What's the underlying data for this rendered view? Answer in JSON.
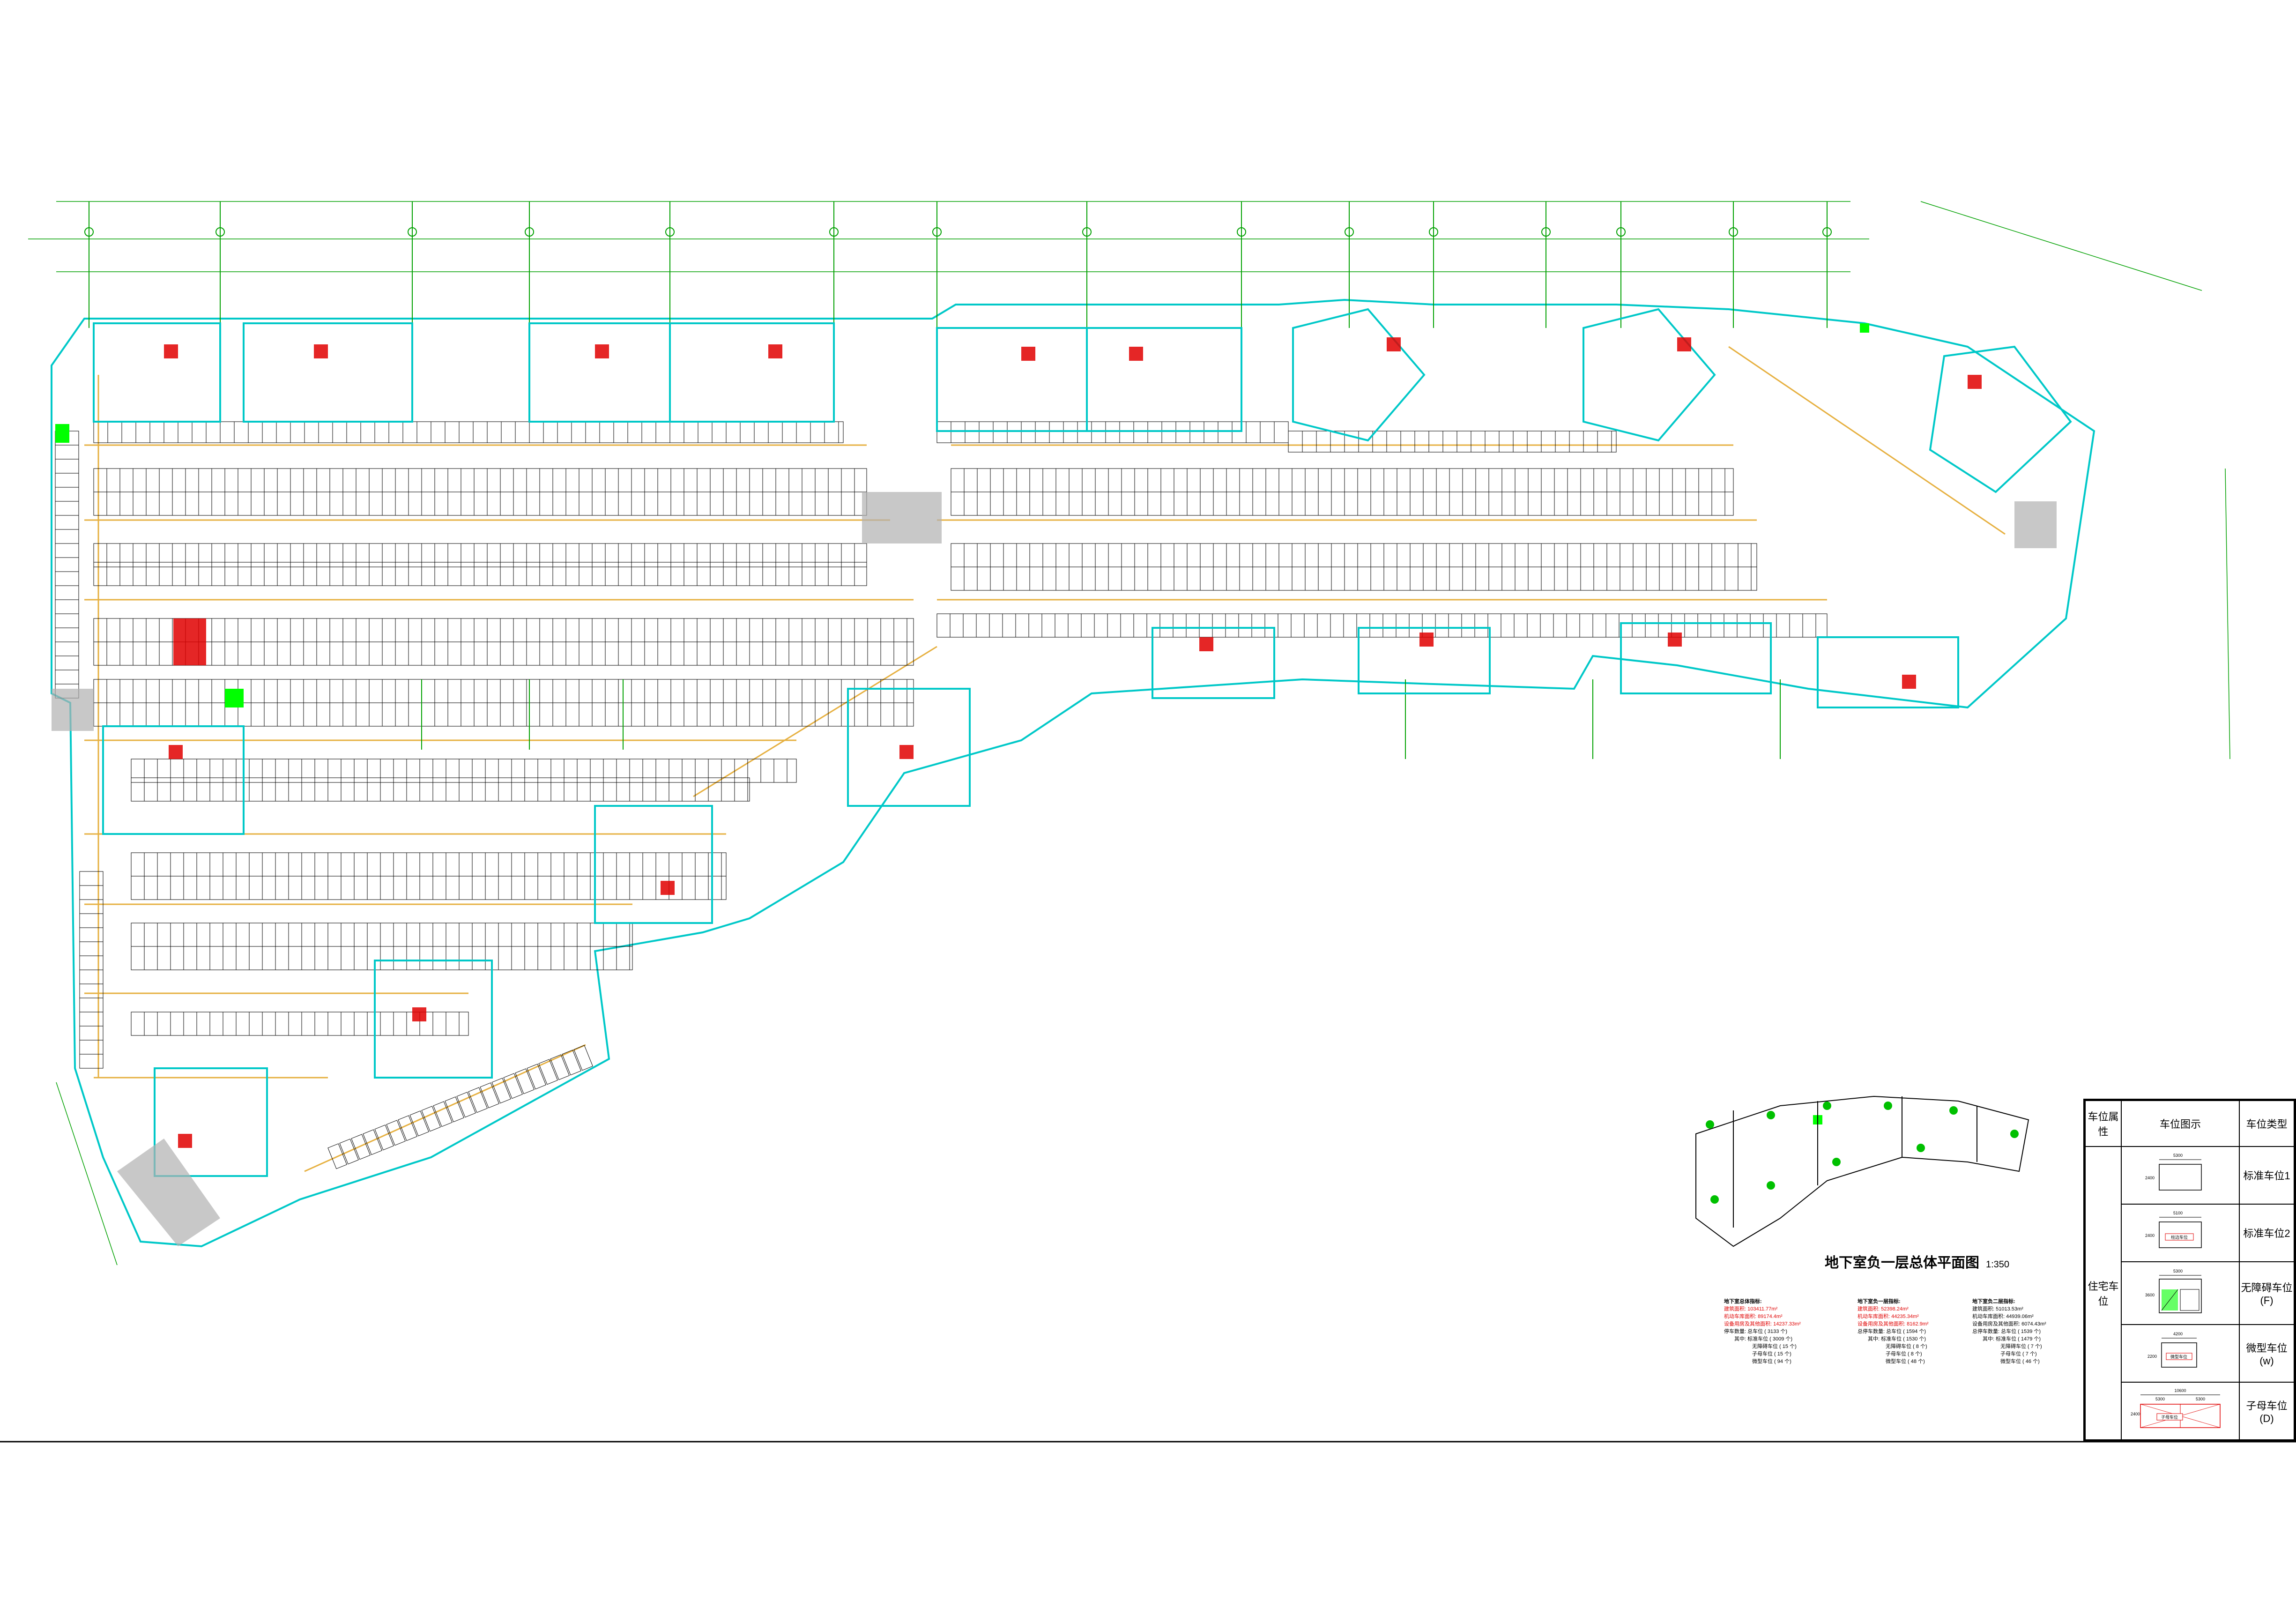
{
  "drawing": {
    "title": "地下室负一层总体平面图",
    "scale": "1:350"
  },
  "stats": [
    {
      "heading": "地下室总体指标:",
      "lines": [
        {
          "text": "建筑面积: 103411.77m²",
          "red": true
        },
        {
          "text": "机动车库面积: 89174.4m²",
          "red": true
        },
        {
          "text": "设备用房及其他面积: 14237.33m²",
          "red": true
        },
        {
          "text": "停车数量: 总车位 ( 3133 个)",
          "red": false
        },
        {
          "text": "其中: 标准车位 ( 3009 个)",
          "red": false
        },
        {
          "text": "无障碍车位 ( 15 个)",
          "red": false
        },
        {
          "text": "子母车位 ( 15 个)",
          "red": false
        },
        {
          "text": "微型车位 ( 94 个)",
          "red": false
        }
      ]
    },
    {
      "heading": "地下室负一层指标:",
      "lines": [
        {
          "text": "建筑面积: 52398.24m²",
          "red": true
        },
        {
          "text": "机动车库面积: 44235.34m²",
          "red": true
        },
        {
          "text": "设备用房及其他面积: 8162.9m²",
          "red": true
        },
        {
          "text": "总停车数量: 总车位 ( 1594 个)",
          "red": false
        },
        {
          "text": "其中: 标准车位 ( 1530 个)",
          "red": false
        },
        {
          "text": "无障碍车位 ( 8 个)",
          "red": false
        },
        {
          "text": "子母车位 ( 8 个)",
          "red": false
        },
        {
          "text": "微型车位 ( 48 个)",
          "red": false
        }
      ]
    },
    {
      "heading": "地下室负二层指标:",
      "lines": [
        {
          "text": "建筑面积: 51013.53m²",
          "red": false
        },
        {
          "text": "机动车库面积: 44939.06m²",
          "red": false
        },
        {
          "text": "设备用房及其他面积: 6074.43m²",
          "red": false
        },
        {
          "text": "总停车数量: 总车位 ( 1539 个)",
          "red": false
        },
        {
          "text": "其中: 标准车位 ( 1479 个)",
          "red": false
        },
        {
          "text": "无障碍车位 ( 7 个)",
          "red": false
        },
        {
          "text": "子母车位 ( 7 个)",
          "red": false
        },
        {
          "text": "微型车位 ( 46 个)",
          "red": false
        }
      ]
    }
  ],
  "legend": {
    "headers": {
      "attr": "车位属性",
      "diagram": "车位图示",
      "type": "车位类型"
    },
    "group": "住宅车位",
    "rows": [
      {
        "type": "标准车位1",
        "dim_w": "5300",
        "dim_h": "2400",
        "inner": ""
      },
      {
        "type": "标准车位2",
        "dim_w": "5100",
        "dim_h": "2400",
        "inner": "柱边车位"
      },
      {
        "type": "无障碍车位(F)",
        "dim_w": "5300",
        "dim_h": "3600",
        "inner": ""
      },
      {
        "type": "微型车位(w)",
        "dim_w": "4200",
        "dim_h": "2200",
        "inner": "微型车位"
      },
      {
        "type": "子母车位(D)",
        "dim_w": "10600",
        "dim_h": "2400",
        "inner": "子母车位",
        "dim_w2": "5300",
        "dim_w3": "5300"
      }
    ]
  },
  "colors": {
    "wall": "#00c8c8",
    "grid_line": "#00a000",
    "parking": "#000000",
    "drive_lane": "#e6b040",
    "equipment": "#e00000",
    "green": "#00ff00"
  }
}
